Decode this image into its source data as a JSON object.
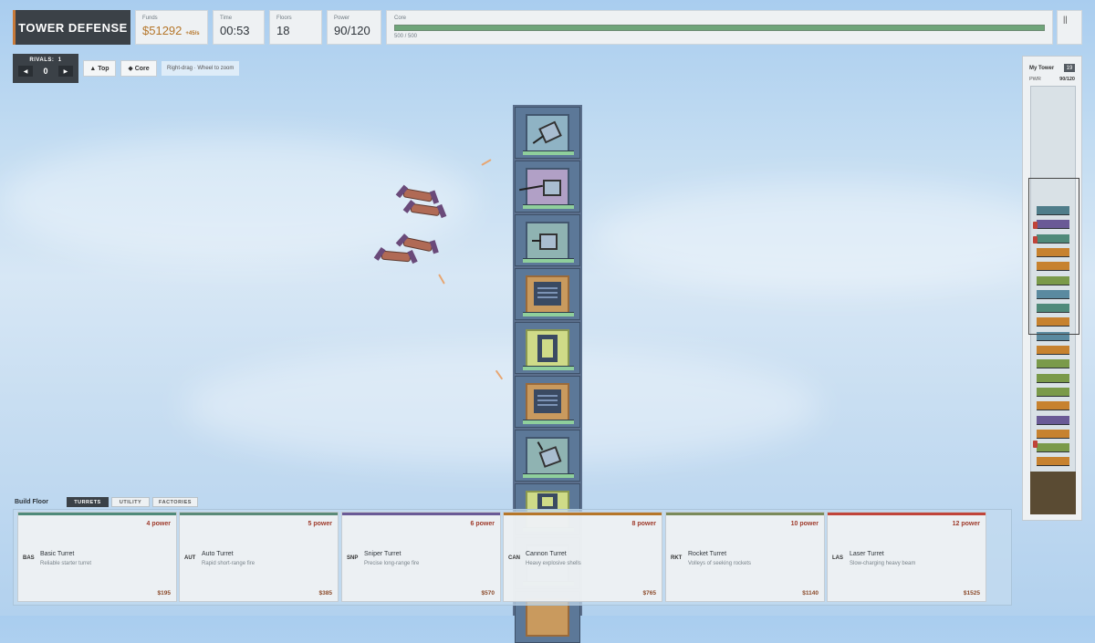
{
  "hud": {
    "title": "TOWER DEFENSE",
    "funds": {
      "label": "Funds",
      "value": "$51292",
      "rate": "+45/s"
    },
    "time": {
      "label": "Time",
      "value": "00:53"
    },
    "floors": {
      "label": "Floors",
      "value": "18"
    },
    "power": {
      "label": "Power",
      "value": "90/120"
    },
    "core": {
      "label": "Core",
      "text": "500 / 500",
      "fraction": 1.0
    },
    "pause_icon": "pause-icon",
    "pause_glyph": "||"
  },
  "rivals": {
    "label": "RIVALS:",
    "count": "1",
    "index": "0",
    "prev_glyph": "◀",
    "next_glyph": "▶"
  },
  "controls": {
    "top_label": "▲ Top",
    "core_label": "◆ Core",
    "hint": "Right-drag · Wheel to zoom"
  },
  "minimap": {
    "title": "My Tower",
    "badge": "19",
    "pwr_label": "PWR",
    "pwr_value": "90/120"
  },
  "build": {
    "label": "Build Floor",
    "tabs": [
      "TURRETS",
      "UTILITY",
      "FACTORIES"
    ],
    "active_tab": "TURRETS",
    "cards": [
      {
        "code": "BAS",
        "name": "Basic Turret",
        "desc": "Reliable starter turret",
        "power": "4 power",
        "price": "$195",
        "color": "#4f8a7a"
      },
      {
        "code": "AUT",
        "name": "Auto Turret",
        "desc": "Rapid short-range fire",
        "power": "5 power",
        "price": "$385",
        "color": "#5a8a78"
      },
      {
        "code": "SNP",
        "name": "Sniper Turret",
        "desc": "Precise long-range fire",
        "power": "6 power",
        "price": "$570",
        "color": "#6a5a96"
      },
      {
        "code": "CAN",
        "name": "Cannon Turret",
        "desc": "Heavy explosive shells",
        "power": "8 power",
        "price": "$765",
        "color": "#b5762a"
      },
      {
        "code": "RKT",
        "name": "Rocket Turret",
        "desc": "Volleys of seeking rockets",
        "power": "10 power",
        "price": "$1140",
        "color": "#7a8a5a"
      },
      {
        "code": "LAS",
        "name": "Laser Turret",
        "desc": "Slow-charging heavy beam",
        "power": "12 power",
        "price": "$1525",
        "color": "#c0443a"
      }
    ]
  },
  "colors": {
    "accent": "#c77a3a",
    "dark_panel": "#3b4147",
    "core_fill": "#6fa57a",
    "price": "#8b4a2a"
  }
}
